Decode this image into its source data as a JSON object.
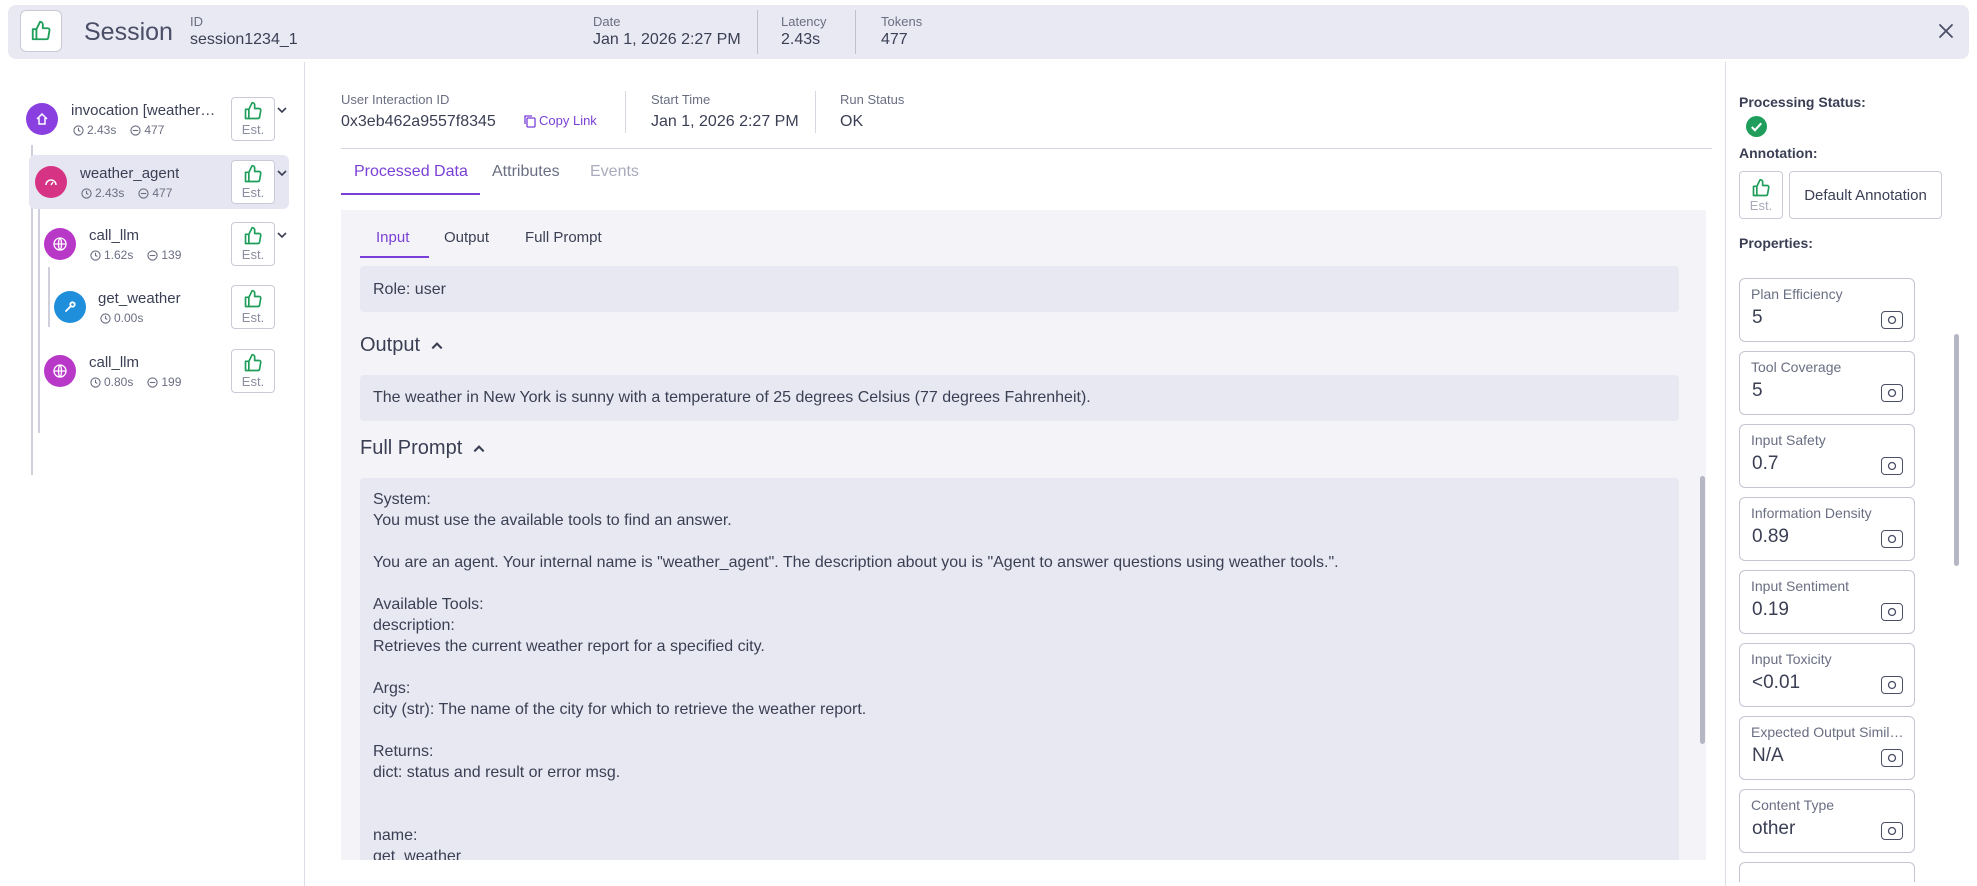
{
  "header": {
    "title": "Session",
    "id_label": "ID",
    "id_value": "session1234_1",
    "date_label": "Date",
    "date_value": "Jan 1, 2026 2:27 PM",
    "latency_label": "Latency",
    "latency_value": "2.43s",
    "tokens_label": "Tokens",
    "tokens_value": "477"
  },
  "tree": {
    "est_label": "Est.",
    "nodes": [
      {
        "name": "invocation [weather_agent]",
        "time": "2.43s",
        "tokens": "477"
      },
      {
        "name": "weather_agent",
        "time": "2.43s",
        "tokens": "477"
      },
      {
        "name": "call_llm",
        "time": "1.62s",
        "tokens": "139"
      },
      {
        "name": "get_weather",
        "time": "0.00s",
        "tokens": ""
      },
      {
        "name": "call_llm",
        "time": "0.80s",
        "tokens": "199"
      }
    ]
  },
  "info": {
    "interaction_label": "User Interaction ID",
    "interaction_value": "0x3eb462a9557f8345",
    "copy_link": "Copy Link",
    "start_label": "Start Time",
    "start_value": "Jan 1, 2026 2:27 PM",
    "status_label": "Run Status",
    "status_value": "OK"
  },
  "tabs": [
    "Processed Data",
    "Attributes",
    "Events"
  ],
  "subtabs": [
    "Input",
    "Output",
    "Full Prompt"
  ],
  "input": {
    "role": "Role: user"
  },
  "output": {
    "heading": "Output",
    "text": "The weather in New York is sunny with a temperature of 25 degrees Celsius (77 degrees Fahrenheit)."
  },
  "full_prompt": {
    "heading": "Full Prompt",
    "lines": [
      "System:",
      "You must use the available tools to find an answer.",
      "",
      "You are an agent. Your internal name is \"weather_agent\". The description about you is \"Agent to answer questions using weather tools.\".",
      "",
      "Available Tools:",
      "description:",
      "Retrieves the current weather report for a specified city.",
      "",
      "Args:",
      "city (str): The name of the city for which to retrieve the weather report.",
      "",
      "Returns:",
      "dict: status and result or error msg.",
      "",
      "",
      "name:",
      "get_weather"
    ]
  },
  "right": {
    "processing_status_label": "Processing Status:",
    "annotation_label": "Annotation:",
    "est_label": "Est.",
    "default_annotation": "Default Annotation",
    "properties_label": "Properties:",
    "properties": [
      {
        "name": "Plan Efficiency",
        "value": "5"
      },
      {
        "name": "Tool Coverage",
        "value": "5"
      },
      {
        "name": "Input Safety",
        "value": "0.7"
      },
      {
        "name": "Information Density",
        "value": "0.89"
      },
      {
        "name": "Input Sentiment",
        "value": "0.19"
      },
      {
        "name": "Input Toxicity",
        "value": "<0.01"
      },
      {
        "name": "Expected Output Similarity",
        "value": "N/A"
      },
      {
        "name": "Content Type",
        "value": "other"
      }
    ]
  },
  "colors": {
    "accent": "#7a3fd6",
    "thumb_green": "#1e9e5a",
    "status_ok": "#1e9e5a",
    "agent_pink": "#d63384",
    "llm_magenta": "#b838c8",
    "tool_blue": "#1f8fdc",
    "invocation_purple": "#8a3fe0"
  }
}
